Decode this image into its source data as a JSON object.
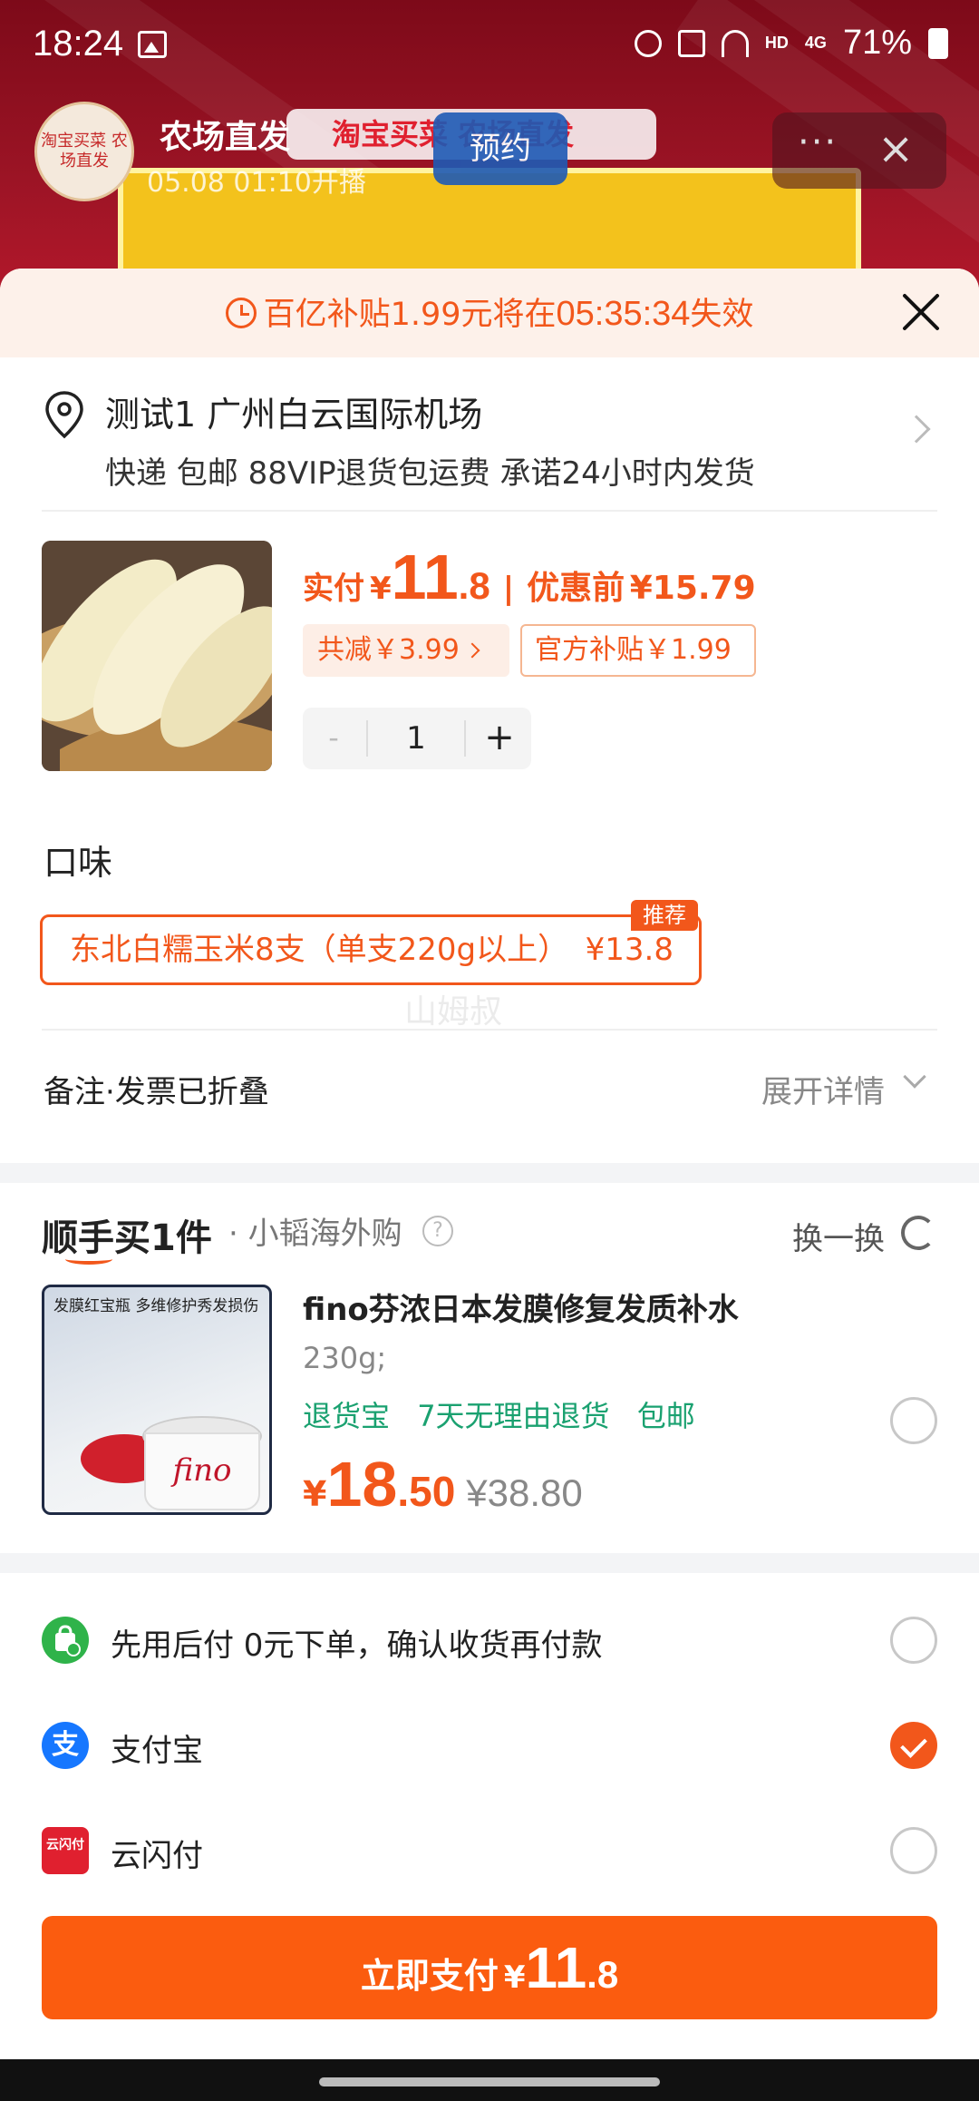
{
  "status_bar": {
    "time": "18:24",
    "hd": "HD",
    "net": "4G",
    "battery": "71%"
  },
  "live": {
    "avatar_text": "淘宝买菜 农场直发",
    "title": "农场直发",
    "tag": "淘宝买菜 农场直发",
    "time": "05.08 01:10开播",
    "reserve_label": "预约",
    "more_label": "···",
    "close_label": "×"
  },
  "countdown": {
    "prefix": "百亿补贴1.99元将在",
    "timer": "05:35:34",
    "suffix": "失效"
  },
  "address": {
    "title": "测试1 广州白云国际机场",
    "delivery": "快递 包邮 88VIP退货包运费 承诺24小时内发货"
  },
  "product": {
    "price_label": "实付",
    "currency": "¥",
    "price_int": "11",
    "price_dec": ".8",
    "separator": "|",
    "original_label": "优惠前",
    "original_price": "¥15.79",
    "discount_total": "共减￥3.99",
    "subsidy": "官方补贴￥1.99",
    "quantity": "1",
    "minus": "-",
    "plus": "+"
  },
  "flavor": {
    "title": "口味",
    "option": "东北白糯玉米8支（单支220g以上）",
    "option_price": "¥13.8",
    "badge": "推荐",
    "watermark": "山姆叔"
  },
  "note": {
    "label": "备注·发票已折叠",
    "expand": "展开详情"
  },
  "addon": {
    "title": "顺手买1件",
    "shop": "· 小韬海外购",
    "help": "?",
    "swap": "换一换",
    "image_header": "发膜红宝瓶 多维修护秀发损伤",
    "image_brand": "fino",
    "name": "fino芬浓日本发膜修复发质补水",
    "spec": "230g;",
    "tags": [
      "退货宝",
      "7天无理由退货",
      "包邮"
    ],
    "currency": "¥",
    "price_int": "18",
    "price_dec": ".50",
    "original_price": "¥38.80"
  },
  "payment": {
    "options": [
      {
        "label": "先用后付  0元下单，确认收货再付款",
        "icon": "shopping-bag-icon",
        "color": "#2fb34a",
        "checked": false
      },
      {
        "label": "支付宝",
        "icon": "alipay-icon",
        "color": "#1677ff",
        "checked": true
      },
      {
        "label": "云闪付",
        "icon": "unionpay-icon",
        "color": "#e0202f",
        "checked": false
      }
    ],
    "unionpay_text": "云闪付",
    "alipay_glyph": "支"
  },
  "pay_button": {
    "label": "立即支付",
    "currency": "¥",
    "int": "11",
    "dec": ".8"
  },
  "colors": {
    "accent": "#f2571b",
    "pay_button": "#fb5c0f",
    "tag_green": "#1aa170"
  }
}
